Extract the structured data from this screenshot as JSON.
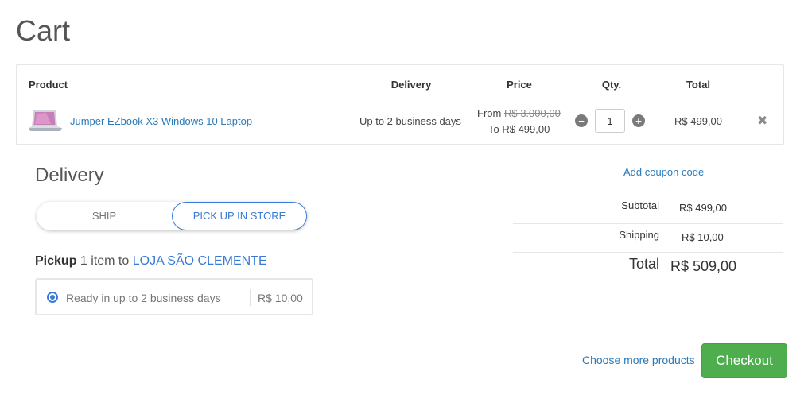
{
  "page": {
    "title": "Cart"
  },
  "cart": {
    "headers": {
      "product": "Product",
      "delivery": "Delivery",
      "price": "Price",
      "qty": "Qty.",
      "total": "Total"
    },
    "items": [
      {
        "name": "Jumper EZbook X3 Windows 10 Laptop",
        "delivery": "Up to 2 business days",
        "price_from_label": "From",
        "price_old": "R$ 3.000,00",
        "price_to": "To R$ 499,00",
        "quantity": "1",
        "total": "R$ 499,00",
        "thumbnail_icon": "laptop-thumbnail",
        "remove_icon": "close-icon"
      }
    ]
  },
  "delivery": {
    "heading": "Delivery",
    "toggle": {
      "ship": "SHIP",
      "pickup": "PICK UP IN STORE",
      "selected": "pickup"
    },
    "pickup_prefix": "Pickup",
    "pickup_count": " 1 item to ",
    "store_name": "LOJA SÃO CLEMENTE",
    "option": {
      "label": "Ready in up to 2 business days",
      "price": "R$ 10,00",
      "selected": true
    }
  },
  "summary": {
    "coupon_link": "Add coupon code",
    "subtotal_label": "Subtotal",
    "subtotal_value": "R$ 499,00",
    "shipping_label": "Shipping",
    "shipping_value": "R$ 10,00",
    "total_label": "Total",
    "total_value": "R$ 509,00"
  },
  "actions": {
    "more_products": "Choose more products",
    "checkout": "Checkout",
    "checkout_color": "#4eae4e"
  }
}
